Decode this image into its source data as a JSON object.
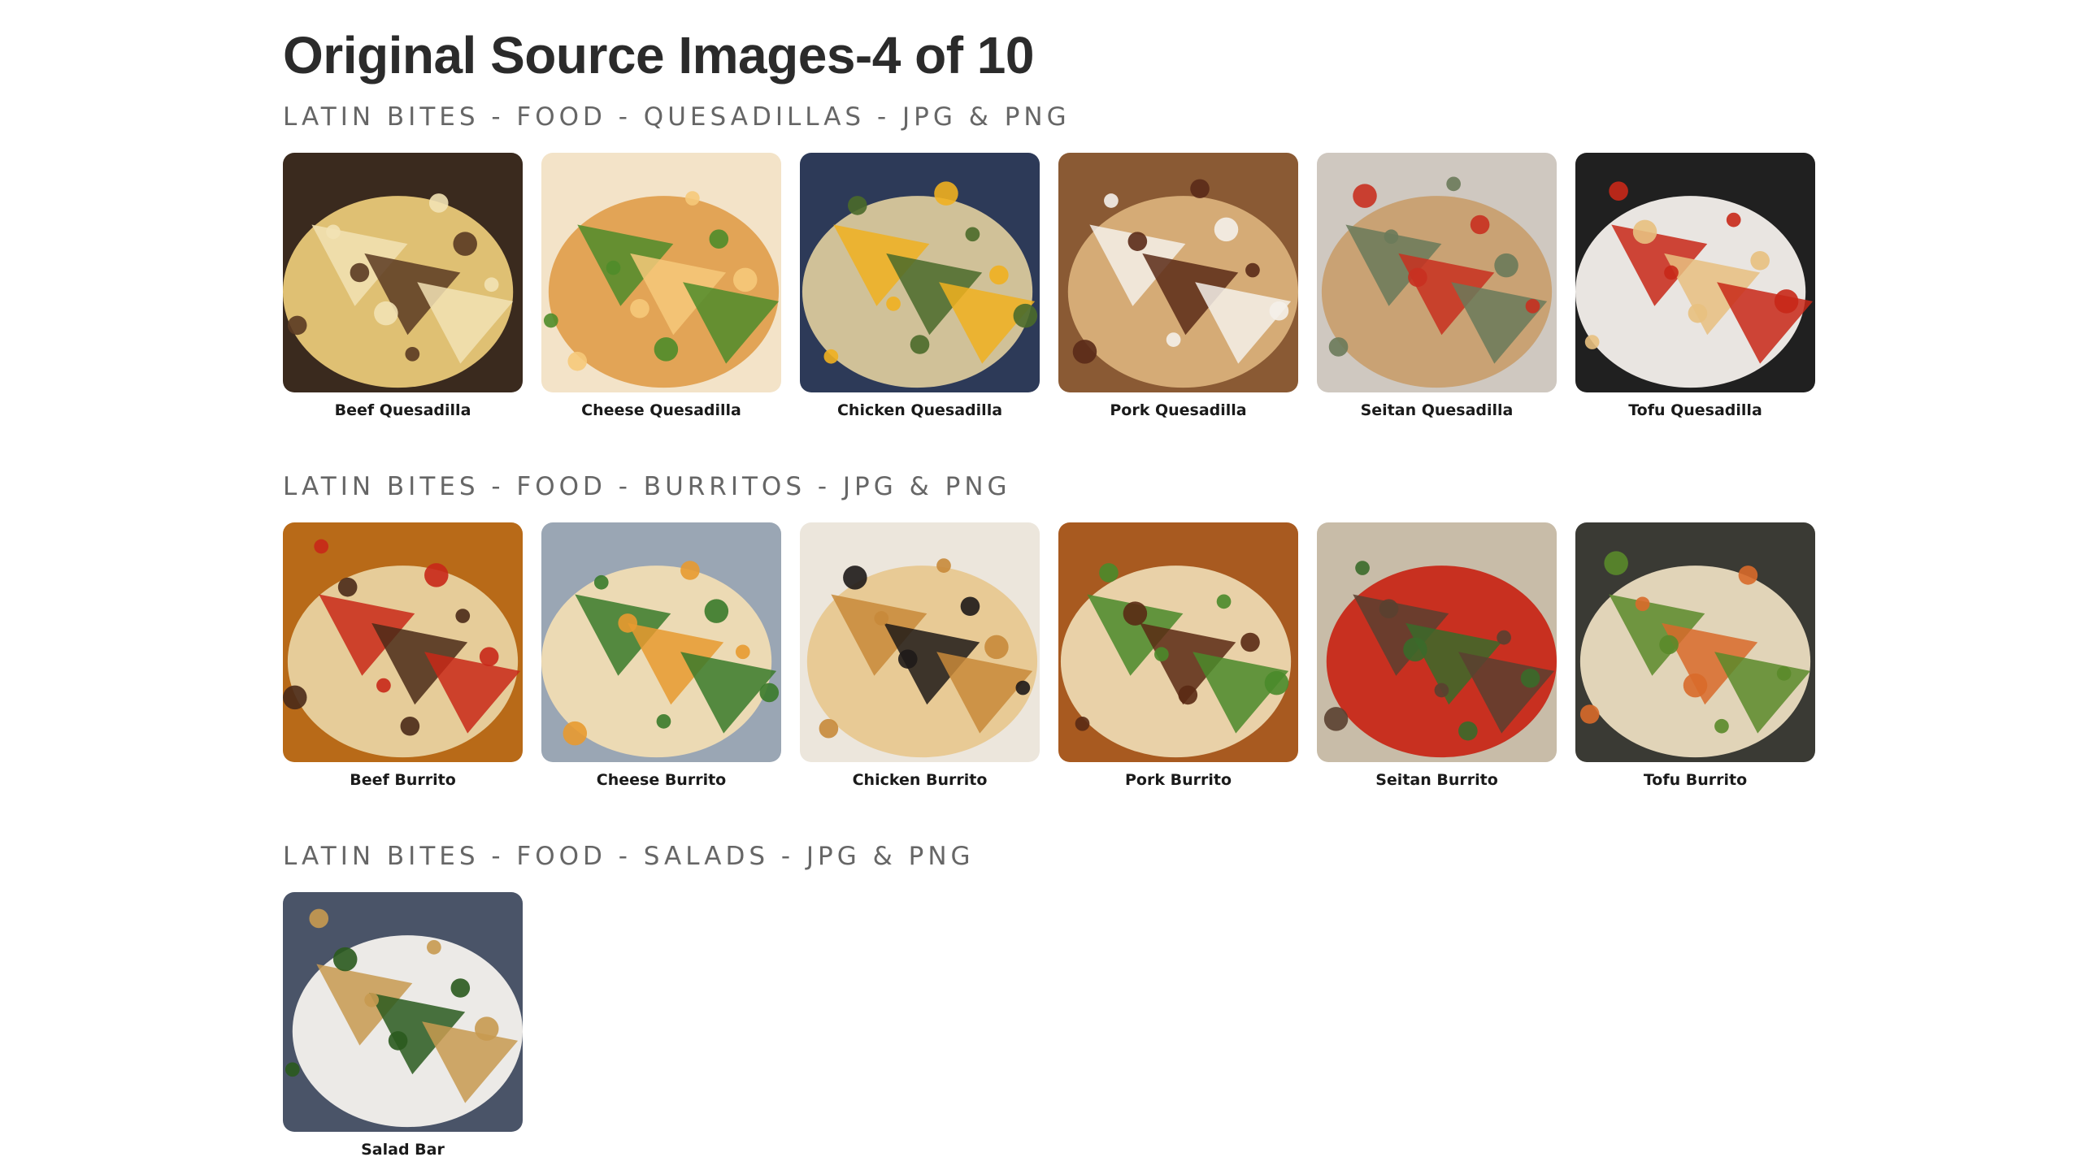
{
  "page": {
    "title": "Original Source Images-4 of 10"
  },
  "sections": [
    {
      "title": "LATIN BITES - FOOD - QUESADILLAS - JPG & PNG",
      "items": [
        {
          "label": "Beef Quesadilla",
          "palette": [
            "#3a2a1e",
            "#e8c878",
            "#5a3a22",
            "#f2e2b4"
          ]
        },
        {
          "label": "Cheese Quesadilla",
          "palette": [
            "#f3e3c8",
            "#e0a050",
            "#f6c97a",
            "#4f8c2a"
          ]
        },
        {
          "label": "Chicken Quesadilla",
          "palette": [
            "#2d3a58",
            "#d9c89c",
            "#4a6a2a",
            "#f0b020"
          ]
        },
        {
          "label": "Pork Quesadilla",
          "palette": [
            "#8a5a34",
            "#d9b07a",
            "#5a2a18",
            "#f4f0ea"
          ]
        },
        {
          "label": "Seitan Quesadilla",
          "palette": [
            "#cfc8c0",
            "#c8a070",
            "#c83020",
            "#6a7a5a"
          ]
        },
        {
          "label": "Tofu Quesadilla",
          "palette": [
            "#202020",
            "#f4f0ec",
            "#e8c080",
            "#c82818"
          ]
        }
      ]
    },
    {
      "title": "LATIN BITES - FOOD - BURRITOS - JPG & PNG",
      "items": [
        {
          "label": "Beef Burrito",
          "palette": [
            "#b86a18",
            "#e8d2a0",
            "#4a2a18",
            "#c82818"
          ]
        },
        {
          "label": "Cheese Burrito",
          "palette": [
            "#9aa6b4",
            "#f0dcb4",
            "#e89a30",
            "#3a7a2a"
          ]
        },
        {
          "label": "Chicken Burrito",
          "palette": [
            "#ece6dc",
            "#e8c890",
            "#1e1a18",
            "#c88a3a"
          ]
        },
        {
          "label": "Pork Burrito",
          "palette": [
            "#a85a20",
            "#ecd8b0",
            "#5a2a14",
            "#4a8a2a"
          ]
        },
        {
          "label": "Seitan Burrito",
          "palette": [
            "#c8bca8",
            "#c82818",
            "#3a6a2a",
            "#5a4030"
          ]
        },
        {
          "label": "Tofu Burrito",
          "palette": [
            "#3a3a34",
            "#eadcc0",
            "#d86a2a",
            "#5a8a2a"
          ]
        }
      ]
    },
    {
      "title": "LATIN BITES - FOOD - SALADS - JPG & PNG",
      "items": [
        {
          "label": "Salad Bar",
          "palette": [
            "#4a5468",
            "#f4f2ee",
            "#2a5a1e",
            "#c89a50"
          ]
        }
      ]
    }
  ]
}
